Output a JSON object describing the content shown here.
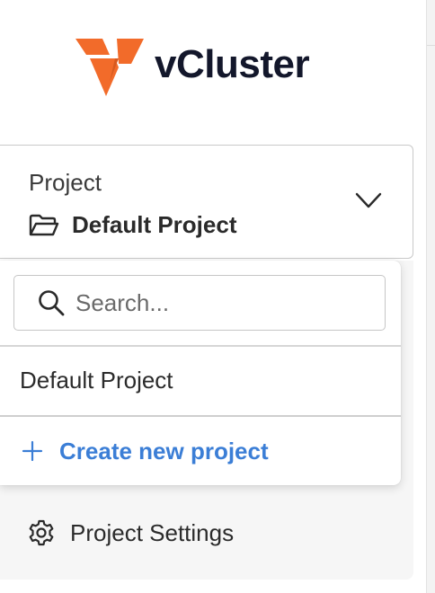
{
  "brand": {
    "name": "vCluster",
    "logo_color": "#f26b2a"
  },
  "project_selector": {
    "label": "Project",
    "selected": "Default Project"
  },
  "dropdown": {
    "search_placeholder": "Search...",
    "options": [
      "Default Project"
    ],
    "create_label": "Create new project",
    "accent_color": "#3b7ed6"
  },
  "nav": {
    "settings_label": "Project Settings"
  }
}
